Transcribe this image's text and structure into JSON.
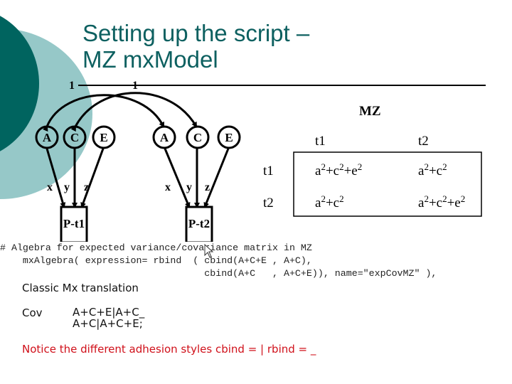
{
  "slide": {
    "title_line1": "Setting up the script –",
    "title_line2": "MZ mxModel",
    "accent_color": "#0d6060",
    "deco_colors": {
      "dark": "#00645f",
      "light": "#96c8c8"
    }
  },
  "path_diagram": {
    "covariance_labels": [
      "1",
      "1"
    ],
    "twin1": {
      "latents": [
        "A",
        "C",
        "E"
      ],
      "paths": [
        "x",
        "y",
        "z"
      ],
      "observed": "P-t1"
    },
    "twin2": {
      "latents": [
        "A",
        "C",
        "E"
      ],
      "paths": [
        "x",
        "y",
        "z"
      ],
      "observed": "P-t2"
    }
  },
  "matrix": {
    "title": "MZ",
    "col_headers": [
      "t1",
      "t2"
    ],
    "row_headers": [
      "t1",
      "t2"
    ],
    "cells": [
      [
        {
          "base": [
            "a",
            "+c",
            "+e"
          ],
          "sup": "2"
        },
        {
          "base": [
            "a",
            "+c"
          ],
          "sup": "2"
        }
      ],
      [
        {
          "base": [
            "a",
            "+c"
          ],
          "sup": "2"
        },
        {
          "base": [
            "a",
            "+c",
            "+e"
          ],
          "sup": "2"
        }
      ]
    ],
    "cell_text": [
      [
        "a2+c2+e2",
        "a2+c2"
      ],
      [
        "a2+c2",
        "a2+c2+e2"
      ]
    ]
  },
  "code": {
    "line1": "# Algebra for expected variance/covariance matrix in MZ",
    "line2": "    mxAlgebra( expression= rbind  ( cbind(A+C+E , A+C),",
    "line3": "                                    cbind(A+C   , A+C+E)), name=\"expCovMZ\" ),"
  },
  "classic": {
    "heading": "Classic Mx translation",
    "label": "Cov",
    "line1": "A+C+E|A+C_",
    "line2": "A+C|A+C+E;"
  },
  "notice": "Notice the different adhesion styles cbind = | rbind = _",
  "cursor": "mouse-pointer"
}
